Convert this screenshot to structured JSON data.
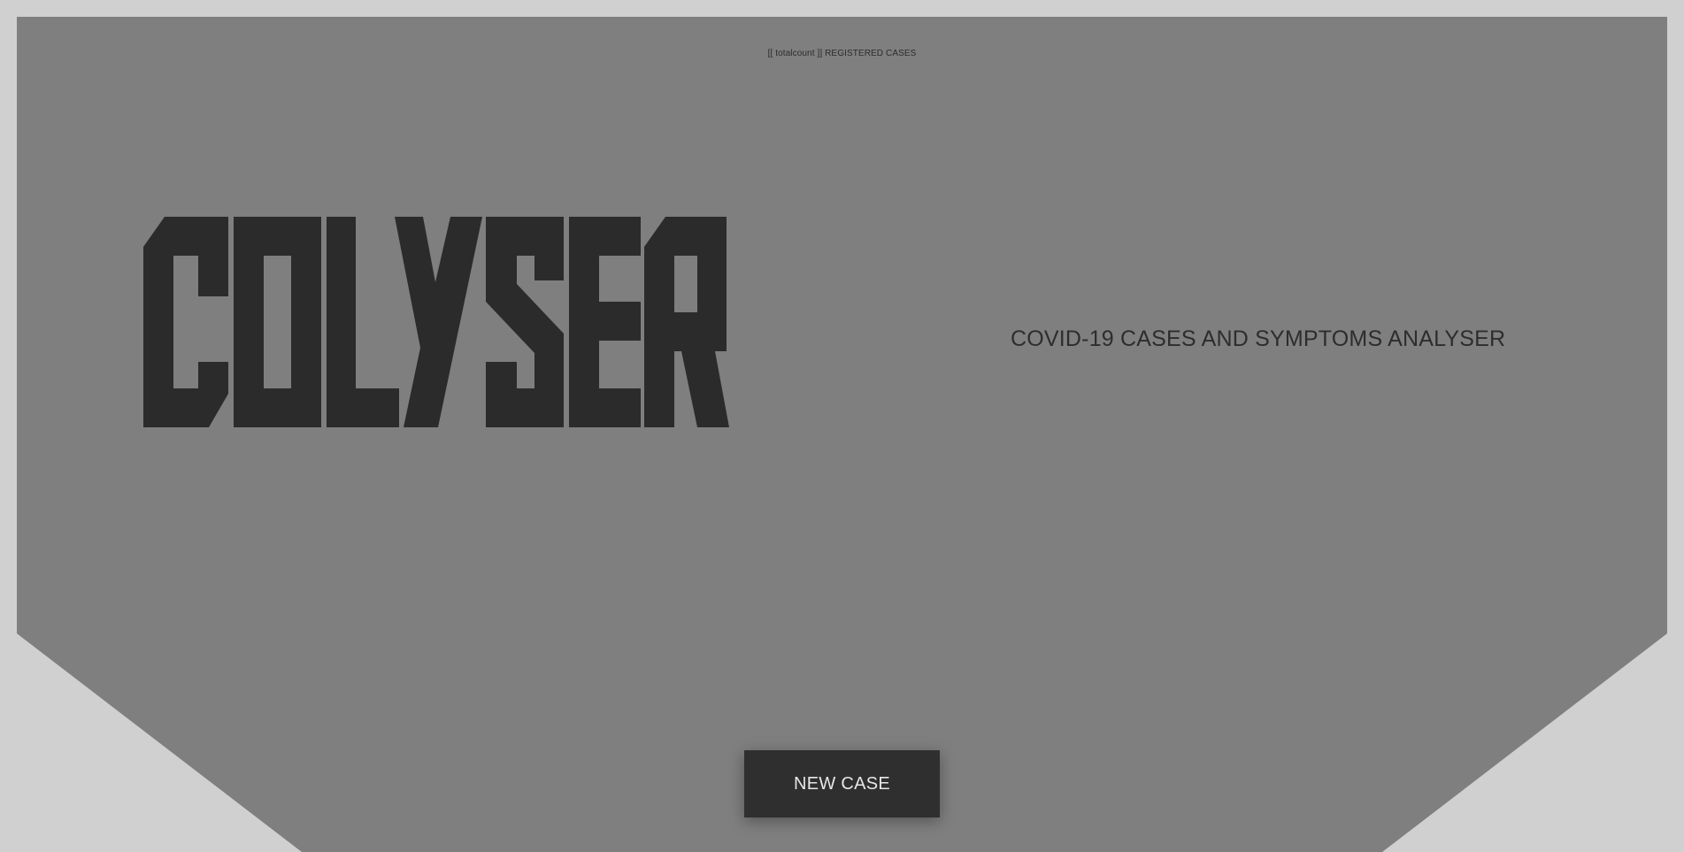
{
  "header": {
    "count_text": "[[ totalcount ]] REGISTERED CASES"
  },
  "hero": {
    "logo_text": "COLYSER",
    "tagline": "COVID-19 CASES AND SYMPTOMS ANALYSER"
  },
  "actions": {
    "new_case_label": "NEW CASE"
  },
  "colors": {
    "page_background": "#d0d0d0",
    "panel": "#7f7f7f",
    "panel_edge": "#545454",
    "logo": "#2b2b2b",
    "button": "#2f2f2f",
    "button_text": "#e6e6e6"
  }
}
